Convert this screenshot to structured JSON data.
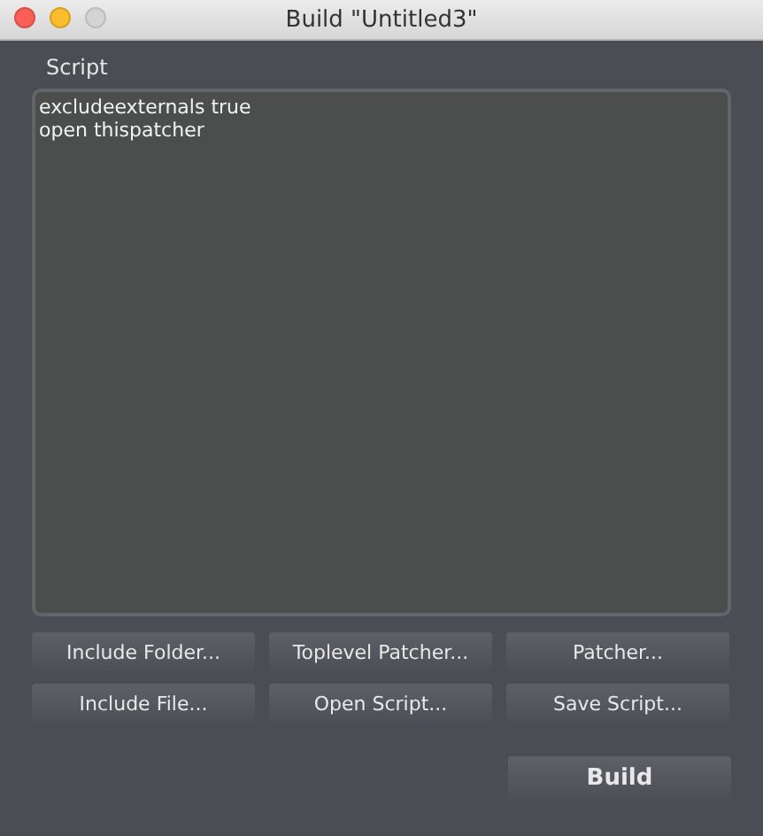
{
  "window": {
    "title": "Build \"Untitled3\"",
    "controls": [
      {
        "kind": "close",
        "disabled": false
      },
      {
        "kind": "minimize",
        "disabled": false
      },
      {
        "kind": "zoom",
        "disabled": true
      }
    ]
  },
  "script": {
    "label": "Script",
    "value": "excludeexternals true\nopen thispatcher"
  },
  "buttons": [
    {
      "label": "Include Folder..."
    },
    {
      "label": "Toplevel Patcher..."
    },
    {
      "label": "Patcher..."
    },
    {
      "label": "Include File..."
    },
    {
      "label": "Open Script..."
    },
    {
      "label": "Save Script..."
    }
  ],
  "build_button": {
    "label": "Build"
  }
}
